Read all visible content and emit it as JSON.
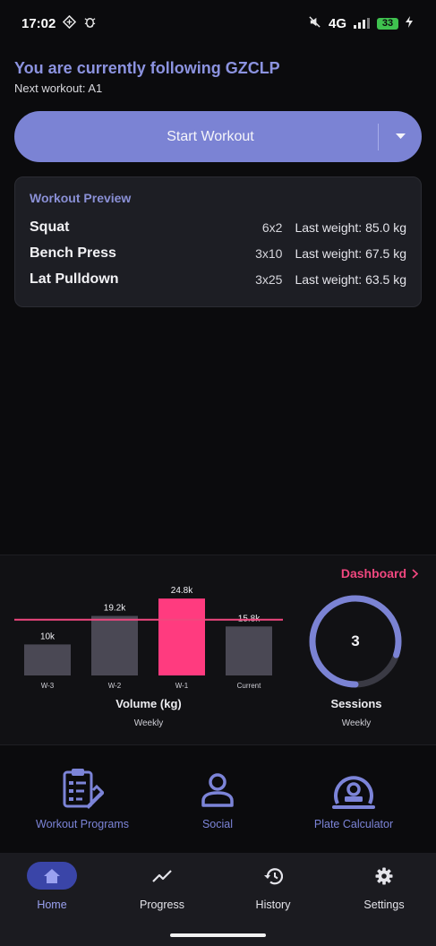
{
  "status_bar": {
    "time": "17:02",
    "left_icons": [
      "data-saver-icon",
      "bug-icon"
    ],
    "right_icons": [
      "mute-icon",
      "signal-icon"
    ],
    "network": "4G",
    "battery": "33"
  },
  "header": {
    "title": "You are currently following GZCLP",
    "next_workout": "Next workout: A1"
  },
  "start_button": {
    "label": "Start Workout",
    "dropdown_icon": "caret-down-icon"
  },
  "preview": {
    "title": "Workout Preview",
    "exercises": [
      {
        "name": "Squat",
        "scheme": "6x2",
        "weight": "Last weight: 85.0 kg"
      },
      {
        "name": "Bench Press",
        "scheme": "3x10",
        "weight": "Last weight: 67.5 kg"
      },
      {
        "name": "Lat Pulldown",
        "scheme": "3x25",
        "weight": "Last weight: 63.5 kg"
      }
    ]
  },
  "stats": {
    "dashboard_label": "Dashboard",
    "volume_title": "Volume (kg)",
    "volume_sub": "Weekly",
    "sessions_title": "Sessions",
    "sessions_sub": "Weekly",
    "sessions_value": "3",
    "sessions_fraction": 0.8,
    "colors": {
      "bar": "#4a4854",
      "highlight": "#ff3b7f",
      "average_line": "#f0477f",
      "ring_fill": "#7b83d4",
      "ring_track": "#3a3a44"
    }
  },
  "chart_data": {
    "type": "bar",
    "categories": [
      "W-3",
      "W-2",
      "W-1",
      "Current"
    ],
    "values": [
      10000,
      19200,
      24800,
      15800
    ],
    "value_labels": [
      "10k",
      "19.2k",
      "24.8k",
      "15.8k"
    ],
    "highlight_index": 2,
    "reference_line": 18000,
    "title": "Volume (kg)",
    "xlabel": "",
    "ylabel": "",
    "ylim": [
      0,
      26000
    ],
    "grid": false
  },
  "shortcuts": [
    {
      "label": "Workout Programs",
      "icon": "clipboard-icon"
    },
    {
      "label": "Social",
      "icon": "person-icon"
    },
    {
      "label": "Plate Calculator",
      "icon": "weight-icon"
    }
  ],
  "nav": [
    {
      "label": "Home",
      "icon": "home-icon",
      "active": true
    },
    {
      "label": "Progress",
      "icon": "trend-icon",
      "active": false
    },
    {
      "label": "History",
      "icon": "history-icon",
      "active": false
    },
    {
      "label": "Settings",
      "icon": "gear-icon",
      "active": false
    }
  ]
}
